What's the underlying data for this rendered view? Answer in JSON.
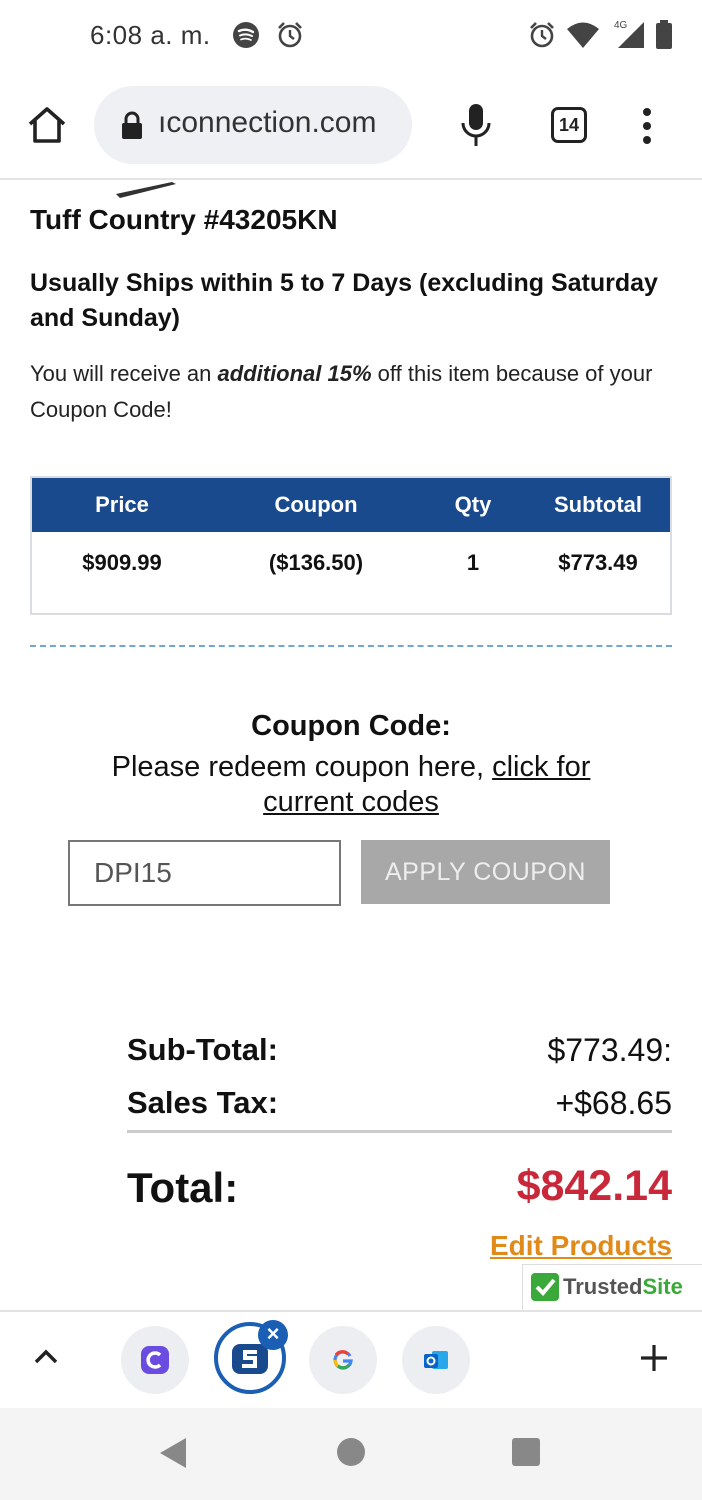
{
  "status_bar": {
    "time": "6:08 a. m.",
    "network_label": "4G",
    "icons": [
      "spotify-icon",
      "alarm-icon",
      "alarm-icon",
      "wifi-icon",
      "signal-icon",
      "battery-icon"
    ]
  },
  "browser": {
    "url": "ıconnection.com",
    "tab_count": "14"
  },
  "product": {
    "title": "Tuff Country #43205KN",
    "shipping": "Usually Ships within 5 to 7 Days (excluding Saturday and Sunday)",
    "coupon_note_prefix": "You will receive an ",
    "coupon_note_emphasis": "additional 15%",
    "coupon_note_suffix": " off this item because of your Coupon Code!"
  },
  "price_table": {
    "headers": [
      "Price",
      "Coupon",
      "Qty",
      "Subtotal"
    ],
    "row": [
      "$909.99",
      "($136.50)",
      "1",
      "$773.49"
    ]
  },
  "coupon": {
    "title": "Coupon Code:",
    "prompt": "Please redeem coupon here, ",
    "link_text": "click for current codes",
    "input_value": "DPI15",
    "apply_label": "APPLY COUPON"
  },
  "totals": {
    "subtotal_label": "Sub-Total:",
    "subtotal_value": "$773.49:",
    "tax_label": "Sales Tax:",
    "tax_value": "+$68.65",
    "total_label": "Total:",
    "total_value": "$842.14",
    "edit_link": "Edit Products"
  },
  "trusted_site": {
    "part1": "Trusted",
    "part2": "Site"
  },
  "colors": {
    "table_header": "#1a4a8e",
    "total": "#c8283a",
    "edit_link": "#e08a1a",
    "apply_button": "#a8a8a8",
    "trusted_green": "#3aa93a"
  }
}
